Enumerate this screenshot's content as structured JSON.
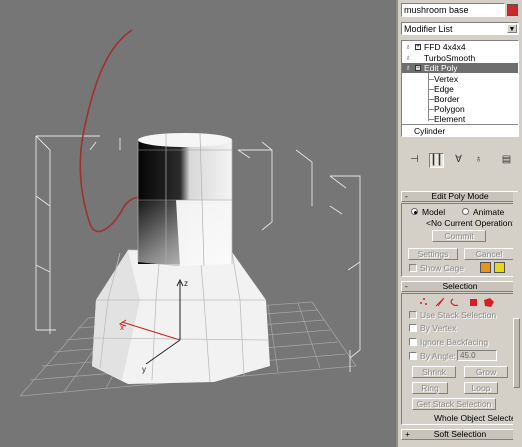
{
  "object": {
    "name": "mushroom base",
    "color": "#cc2a2a"
  },
  "modifier_list": {
    "label": "Modifier List"
  },
  "stack": {
    "modifiers": [
      {
        "label": "FFD 4x4x4",
        "expanded": false,
        "selected": false
      },
      {
        "label": "TurboSmooth",
        "expanded": false,
        "selected": false
      },
      {
        "label": "Edit Poly",
        "expanded": true,
        "selected": true
      }
    ],
    "sub_objects": [
      "Vertex",
      "Edge",
      "Border",
      "Polygon",
      "Element"
    ],
    "base_object": "Cylinder"
  },
  "toolbar": {
    "buttons": [
      "pin-stack",
      "show-end-result",
      "make-unique",
      "remove-modifier",
      "configure-modifier-sets"
    ]
  },
  "edit_poly_mode": {
    "header": "Edit Poly Mode",
    "toggle": "-",
    "model_label": "Model",
    "animate_label": "Animate",
    "mode_selected": "Model",
    "current_op": "<No Current Operation>",
    "commit_label": "Commit",
    "settings_label": "Settings",
    "cancel_label": "Cancel",
    "show_cage_label": "Show Cage",
    "cage_colors": [
      "#e8941a",
      "#e8d81a"
    ]
  },
  "selection": {
    "header": "Selection",
    "toggle": "-",
    "use_stack_label": "Use Stack Selection",
    "by_vertex_label": "By Vertex",
    "ignore_backfacing_label": "Ignore Backfacing",
    "by_angle_label": "By Angle:",
    "by_angle_value": "45.0",
    "shrink_label": "Shrink",
    "grow_label": "Grow",
    "ring_label": "Ring",
    "loop_label": "Loop",
    "get_stack_label": "Get Stack Selection",
    "status": "Whole Object Selected",
    "subobject_icon_names": [
      "vertex-icon",
      "edge-icon",
      "border-icon",
      "polygon-icon",
      "element-icon"
    ],
    "accent": "#d42020"
  },
  "soft_selection": {
    "header": "Soft Selection",
    "toggle": "+"
  },
  "viewport": {
    "grid_color": "#a8a8a8",
    "spline_color": "#a03030",
    "gizmo_color": "#e8e8e8",
    "axes": {
      "x": "x",
      "y": "y",
      "z": "z"
    }
  }
}
